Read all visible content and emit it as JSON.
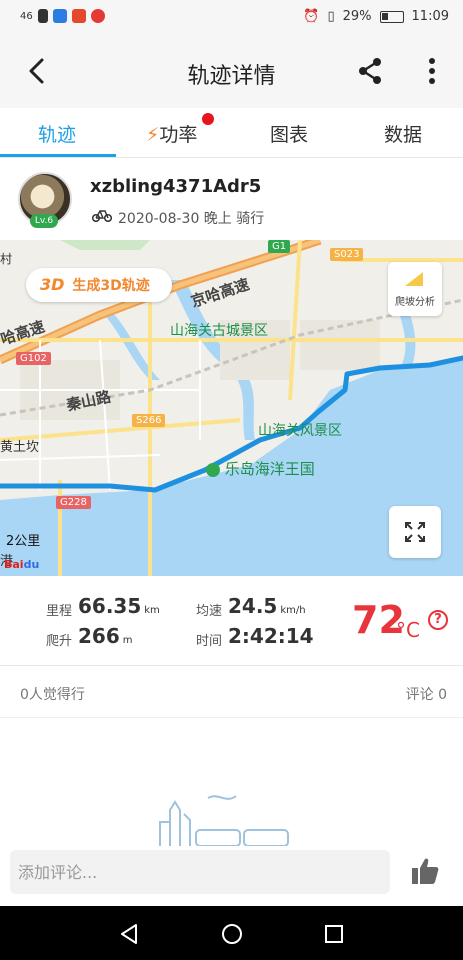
{
  "status_bar": {
    "signal": "46",
    "battery_percent": "29%",
    "time": "11:09"
  },
  "appbar": {
    "title": "轨迹详情"
  },
  "tabs": [
    {
      "label": "轨迹",
      "active": true
    },
    {
      "label": "功率",
      "active": false,
      "has_badge": true
    },
    {
      "label": "图表",
      "active": false
    },
    {
      "label": "数据",
      "active": false
    }
  ],
  "user": {
    "name": "xzbling4371Adr5",
    "level": "Lv.6",
    "date_line": "2020-08-30 晚上 骑行"
  },
  "map": {
    "button_3d": "生成3D轨迹",
    "button_3d_prefix": "3D",
    "slope_label": "爬坡分析",
    "scale": "2公里",
    "labels": {
      "expressway_1": "京哈高速",
      "expressway_2": "哈高速",
      "scenic_1": "山海关古城景区",
      "scenic_2": "山海关风景区",
      "park": "乐岛海洋王国",
      "road": "秦山路",
      "place": "黄土坎",
      "village": "村",
      "port": "港"
    },
    "tags": {
      "g102": "G102",
      "g228": "G228",
      "s266": "S266",
      "s023": "S023",
      "g1": "G1"
    }
  },
  "stats": {
    "distance_label": "里程",
    "distance_value": "66.35",
    "distance_unit": "km",
    "climb_label": "爬升",
    "climb_value": "266",
    "climb_unit": "m",
    "speed_label": "均速",
    "speed_value": "24.5",
    "speed_unit": "km/h",
    "time_label": "时间",
    "time_value": "2:42:14",
    "temperature": "72",
    "temperature_unit": "°C",
    "help": "?"
  },
  "social": {
    "likes": "0人觉得行",
    "comments": "评论 0"
  },
  "comment_bar": {
    "placeholder": "添加评论..."
  },
  "colors": {
    "accent": "#1ea0e6",
    "route": "#1ea0e6",
    "temp": "#e8343b",
    "badge": "#e8141c"
  }
}
